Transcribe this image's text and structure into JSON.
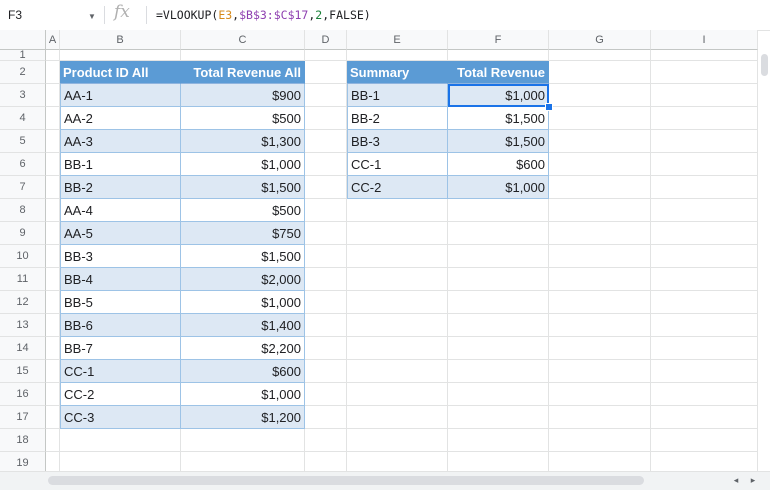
{
  "formula_bar": {
    "cell_ref": "F3",
    "fx_label": "fx",
    "formula_parts": [
      "=VLOOKUP(",
      "E3",
      ",",
      "$B$3:$C$17",
      ",",
      "2",
      ",",
      "FALSE",
      ")"
    ]
  },
  "columns": [
    "A",
    "B",
    "C",
    "D",
    "E",
    "F",
    "G",
    "I"
  ],
  "rows": [
    "1",
    "2",
    "3",
    "4",
    "5",
    "6",
    "7",
    "8",
    "9",
    "10",
    "11",
    "12",
    "13",
    "14",
    "15",
    "16",
    "17",
    "18",
    "19"
  ],
  "table_all": {
    "headers": [
      "Product ID All",
      "Total Revenue All"
    ],
    "rows": [
      [
        "AA-1",
        "$900"
      ],
      [
        "AA-2",
        "$500"
      ],
      [
        "AA-3",
        "$1,300"
      ],
      [
        "BB-1",
        "$1,000"
      ],
      [
        "BB-2",
        "$1,500"
      ],
      [
        "AA-4",
        "$500"
      ],
      [
        "AA-5",
        "$750"
      ],
      [
        "BB-3",
        "$1,500"
      ],
      [
        "BB-4",
        "$2,000"
      ],
      [
        "BB-5",
        "$1,000"
      ],
      [
        "BB-6",
        "$1,400"
      ],
      [
        "BB-7",
        "$2,200"
      ],
      [
        "CC-1",
        "$600"
      ],
      [
        "CC-2",
        "$1,000"
      ],
      [
        "CC-3",
        "$1,200"
      ]
    ]
  },
  "table_summary": {
    "headers": [
      "Summary",
      "Total Revenue"
    ],
    "rows": [
      [
        "BB-1",
        "$1,000"
      ],
      [
        "BB-2",
        "$1,500"
      ],
      [
        "BB-3",
        "$1,500"
      ],
      [
        "CC-1",
        "$600"
      ],
      [
        "CC-2",
        "$1,000"
      ]
    ]
  },
  "colors": {
    "header_fill": "#5b9bd5",
    "band_fill": "#dde8f4",
    "selection": "#1a73e8"
  },
  "icons": {
    "dropdown": "chevron-down-icon",
    "scroll_left": "arrow-left-icon",
    "scroll_right": "arrow-right-icon"
  }
}
